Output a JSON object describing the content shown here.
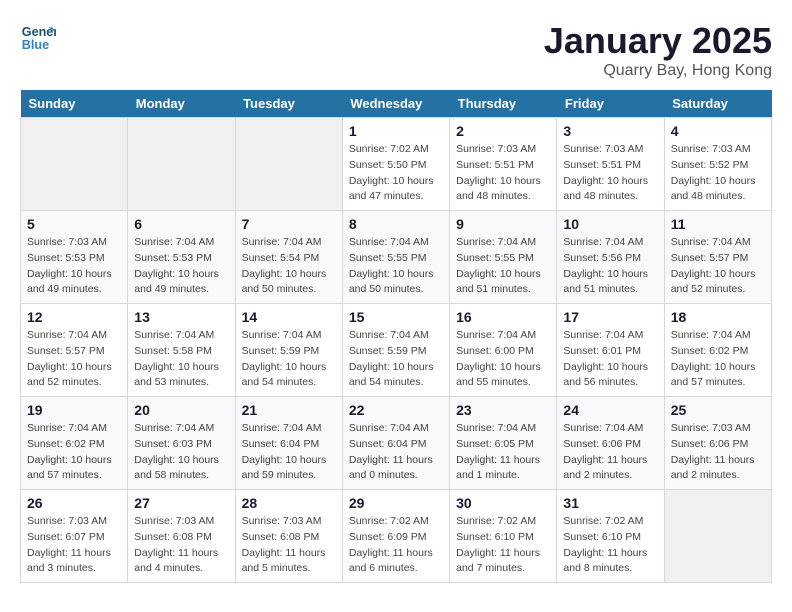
{
  "logo": {
    "line1": "General",
    "line2": "Blue"
  },
  "title": "January 2025",
  "subtitle": "Quarry Bay, Hong Kong",
  "days_of_week": [
    "Sunday",
    "Monday",
    "Tuesday",
    "Wednesday",
    "Thursday",
    "Friday",
    "Saturday"
  ],
  "weeks": [
    [
      {
        "day": "",
        "sunrise": "",
        "sunset": "",
        "daylight": ""
      },
      {
        "day": "",
        "sunrise": "",
        "sunset": "",
        "daylight": ""
      },
      {
        "day": "",
        "sunrise": "",
        "sunset": "",
        "daylight": ""
      },
      {
        "day": "1",
        "sunrise": "Sunrise: 7:02 AM",
        "sunset": "Sunset: 5:50 PM",
        "daylight": "Daylight: 10 hours and 47 minutes."
      },
      {
        "day": "2",
        "sunrise": "Sunrise: 7:03 AM",
        "sunset": "Sunset: 5:51 PM",
        "daylight": "Daylight: 10 hours and 48 minutes."
      },
      {
        "day": "3",
        "sunrise": "Sunrise: 7:03 AM",
        "sunset": "Sunset: 5:51 PM",
        "daylight": "Daylight: 10 hours and 48 minutes."
      },
      {
        "day": "4",
        "sunrise": "Sunrise: 7:03 AM",
        "sunset": "Sunset: 5:52 PM",
        "daylight": "Daylight: 10 hours and 48 minutes."
      }
    ],
    [
      {
        "day": "5",
        "sunrise": "Sunrise: 7:03 AM",
        "sunset": "Sunset: 5:53 PM",
        "daylight": "Daylight: 10 hours and 49 minutes."
      },
      {
        "day": "6",
        "sunrise": "Sunrise: 7:04 AM",
        "sunset": "Sunset: 5:53 PM",
        "daylight": "Daylight: 10 hours and 49 minutes."
      },
      {
        "day": "7",
        "sunrise": "Sunrise: 7:04 AM",
        "sunset": "Sunset: 5:54 PM",
        "daylight": "Daylight: 10 hours and 50 minutes."
      },
      {
        "day": "8",
        "sunrise": "Sunrise: 7:04 AM",
        "sunset": "Sunset: 5:55 PM",
        "daylight": "Daylight: 10 hours and 50 minutes."
      },
      {
        "day": "9",
        "sunrise": "Sunrise: 7:04 AM",
        "sunset": "Sunset: 5:55 PM",
        "daylight": "Daylight: 10 hours and 51 minutes."
      },
      {
        "day": "10",
        "sunrise": "Sunrise: 7:04 AM",
        "sunset": "Sunset: 5:56 PM",
        "daylight": "Daylight: 10 hours and 51 minutes."
      },
      {
        "day": "11",
        "sunrise": "Sunrise: 7:04 AM",
        "sunset": "Sunset: 5:57 PM",
        "daylight": "Daylight: 10 hours and 52 minutes."
      }
    ],
    [
      {
        "day": "12",
        "sunrise": "Sunrise: 7:04 AM",
        "sunset": "Sunset: 5:57 PM",
        "daylight": "Daylight: 10 hours and 52 minutes."
      },
      {
        "day": "13",
        "sunrise": "Sunrise: 7:04 AM",
        "sunset": "Sunset: 5:58 PM",
        "daylight": "Daylight: 10 hours and 53 minutes."
      },
      {
        "day": "14",
        "sunrise": "Sunrise: 7:04 AM",
        "sunset": "Sunset: 5:59 PM",
        "daylight": "Daylight: 10 hours and 54 minutes."
      },
      {
        "day": "15",
        "sunrise": "Sunrise: 7:04 AM",
        "sunset": "Sunset: 5:59 PM",
        "daylight": "Daylight: 10 hours and 54 minutes."
      },
      {
        "day": "16",
        "sunrise": "Sunrise: 7:04 AM",
        "sunset": "Sunset: 6:00 PM",
        "daylight": "Daylight: 10 hours and 55 minutes."
      },
      {
        "day": "17",
        "sunrise": "Sunrise: 7:04 AM",
        "sunset": "Sunset: 6:01 PM",
        "daylight": "Daylight: 10 hours and 56 minutes."
      },
      {
        "day": "18",
        "sunrise": "Sunrise: 7:04 AM",
        "sunset": "Sunset: 6:02 PM",
        "daylight": "Daylight: 10 hours and 57 minutes."
      }
    ],
    [
      {
        "day": "19",
        "sunrise": "Sunrise: 7:04 AM",
        "sunset": "Sunset: 6:02 PM",
        "daylight": "Daylight: 10 hours and 57 minutes."
      },
      {
        "day": "20",
        "sunrise": "Sunrise: 7:04 AM",
        "sunset": "Sunset: 6:03 PM",
        "daylight": "Daylight: 10 hours and 58 minutes."
      },
      {
        "day": "21",
        "sunrise": "Sunrise: 7:04 AM",
        "sunset": "Sunset: 6:04 PM",
        "daylight": "Daylight: 10 hours and 59 minutes."
      },
      {
        "day": "22",
        "sunrise": "Sunrise: 7:04 AM",
        "sunset": "Sunset: 6:04 PM",
        "daylight": "Daylight: 11 hours and 0 minutes."
      },
      {
        "day": "23",
        "sunrise": "Sunrise: 7:04 AM",
        "sunset": "Sunset: 6:05 PM",
        "daylight": "Daylight: 11 hours and 1 minute."
      },
      {
        "day": "24",
        "sunrise": "Sunrise: 7:04 AM",
        "sunset": "Sunset: 6:06 PM",
        "daylight": "Daylight: 11 hours and 2 minutes."
      },
      {
        "day": "25",
        "sunrise": "Sunrise: 7:03 AM",
        "sunset": "Sunset: 6:06 PM",
        "daylight": "Daylight: 11 hours and 2 minutes."
      }
    ],
    [
      {
        "day": "26",
        "sunrise": "Sunrise: 7:03 AM",
        "sunset": "Sunset: 6:07 PM",
        "daylight": "Daylight: 11 hours and 3 minutes."
      },
      {
        "day": "27",
        "sunrise": "Sunrise: 7:03 AM",
        "sunset": "Sunset: 6:08 PM",
        "daylight": "Daylight: 11 hours and 4 minutes."
      },
      {
        "day": "28",
        "sunrise": "Sunrise: 7:03 AM",
        "sunset": "Sunset: 6:08 PM",
        "daylight": "Daylight: 11 hours and 5 minutes."
      },
      {
        "day": "29",
        "sunrise": "Sunrise: 7:02 AM",
        "sunset": "Sunset: 6:09 PM",
        "daylight": "Daylight: 11 hours and 6 minutes."
      },
      {
        "day": "30",
        "sunrise": "Sunrise: 7:02 AM",
        "sunset": "Sunset: 6:10 PM",
        "daylight": "Daylight: 11 hours and 7 minutes."
      },
      {
        "day": "31",
        "sunrise": "Sunrise: 7:02 AM",
        "sunset": "Sunset: 6:10 PM",
        "daylight": "Daylight: 11 hours and 8 minutes."
      },
      {
        "day": "",
        "sunrise": "",
        "sunset": "",
        "daylight": ""
      }
    ]
  ]
}
